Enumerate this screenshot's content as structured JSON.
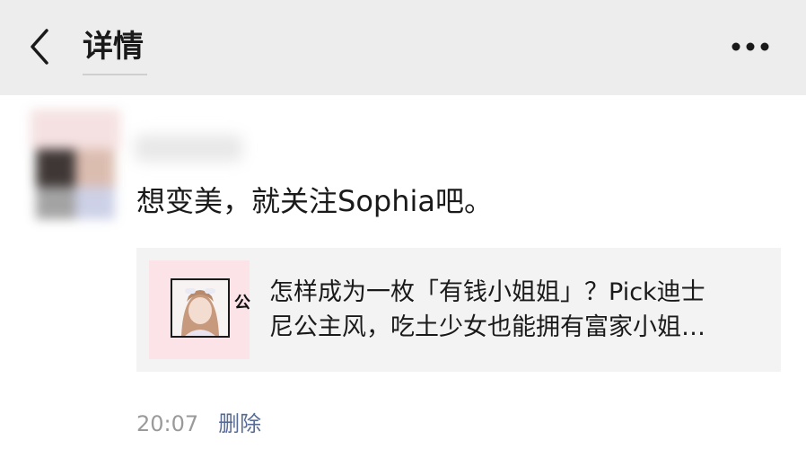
{
  "header": {
    "title": "详情",
    "back_icon": "chevron-left-icon",
    "more_icon": "more-dots-icon"
  },
  "post": {
    "text": "想变美，就关注Sophia吧。",
    "avatar_icon": "avatar",
    "shared_article": {
      "title_line1": "怎样成为一枚「有钱小姐姐」？Pick迪士",
      "title_line2": "尼公主风，吃土少女也能拥有富家小姐…",
      "badge_text": "公"
    },
    "timestamp": "20:07",
    "delete_label": "删除"
  },
  "colors": {
    "navbar_bg": "#ededed",
    "link_blue": "#576b95",
    "card_bg": "#f3f3f3",
    "thumb_bg": "#fbe3e8"
  }
}
